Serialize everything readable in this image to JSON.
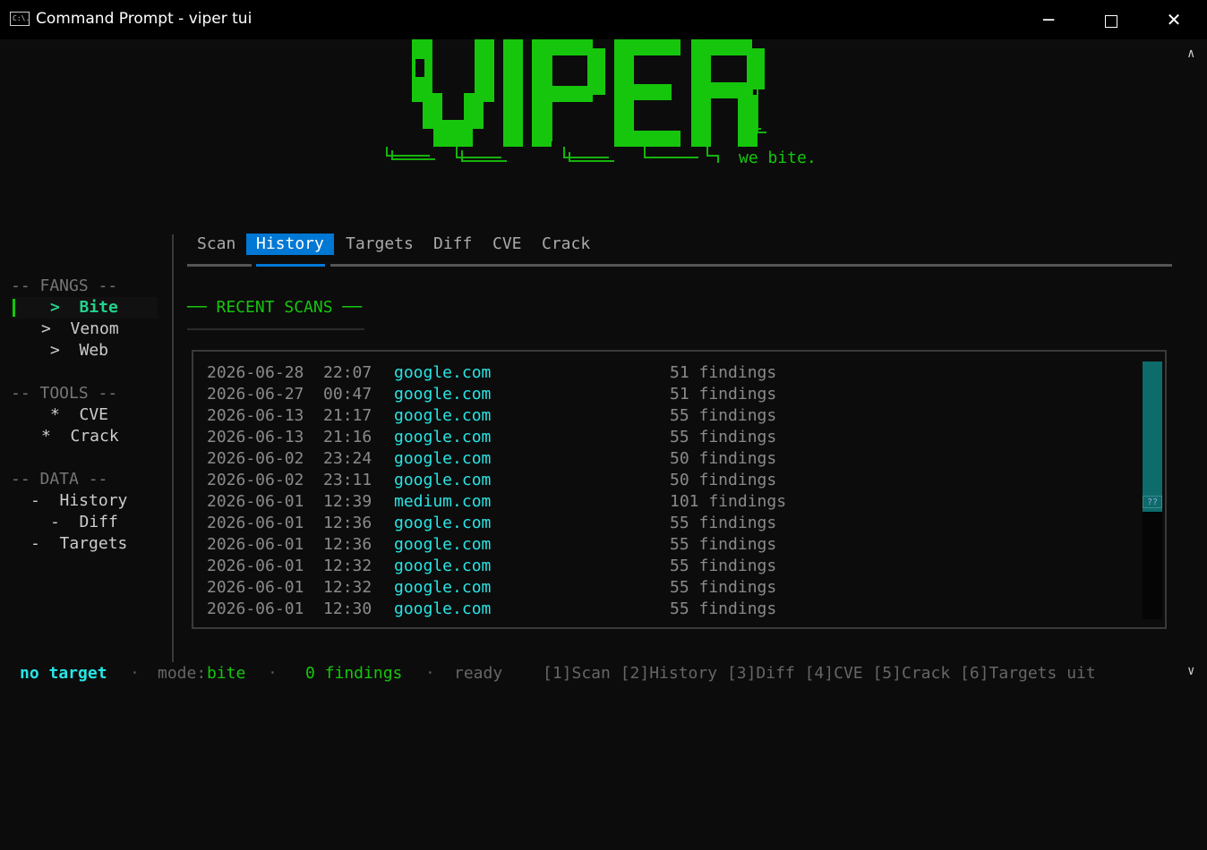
{
  "window": {
    "icon_text": "C:\\.",
    "title": "Command Prompt - viper  tui",
    "minimize": "─",
    "close": "✕"
  },
  "logo": {
    "text": "VIPER",
    "tagline": "we bite.",
    "color": "#16c60c"
  },
  "sidebar": {
    "sections": [
      {
        "title": "-- FANGS --",
        "items": [
          {
            "label": ">  Bite",
            "active": true
          },
          {
            "label": ">  Venom"
          },
          {
            "label": ">  Web"
          }
        ]
      },
      {
        "title": "-- TOOLS --",
        "items": [
          {
            "label": "*  CVE"
          },
          {
            "label": "*  Crack"
          }
        ]
      },
      {
        "title": "-- DATA --",
        "items": [
          {
            "label": "-  History"
          },
          {
            "label": "-  Diff"
          },
          {
            "label": "-  Targets"
          }
        ]
      }
    ]
  },
  "tabs": [
    {
      "label": "Scan"
    },
    {
      "label": "History",
      "active": true
    },
    {
      "label": "Targets"
    },
    {
      "label": "Diff"
    },
    {
      "label": "CVE"
    },
    {
      "label": "Crack"
    }
  ],
  "section_title": "── RECENT SCANS ──",
  "scans": [
    {
      "date": "2026-06-28  22:07",
      "host": "google.com",
      "findings": "51 findings"
    },
    {
      "date": "2026-06-27  00:47",
      "host": "google.com",
      "findings": "51 findings"
    },
    {
      "date": "2026-06-13  21:17",
      "host": "google.com",
      "findings": "55 findings"
    },
    {
      "date": "2026-06-13  21:16",
      "host": "google.com",
      "findings": "55 findings"
    },
    {
      "date": "2026-06-02  23:24",
      "host": "google.com",
      "findings": "50 findings"
    },
    {
      "date": "2026-06-02  23:11",
      "host": "google.com",
      "findings": "50 findings"
    },
    {
      "date": "2026-06-01  12:39",
      "host": "medium.com",
      "findings": "101 findings"
    },
    {
      "date": "2026-06-01  12:36",
      "host": "google.com",
      "findings": "55 findings"
    },
    {
      "date": "2026-06-01  12:36",
      "host": "google.com",
      "findings": "55 findings"
    },
    {
      "date": "2026-06-01  12:32",
      "host": "google.com",
      "findings": "55 findings"
    },
    {
      "date": "2026-06-01  12:32",
      "host": "google.com",
      "findings": "55 findings"
    },
    {
      "date": "2026-06-01  12:30",
      "host": "google.com",
      "findings": "55 findings"
    }
  ],
  "scrollbar_glyph": "??",
  "status": {
    "target": "no target",
    "separator": "·",
    "mode_label": "mode:",
    "mode": "bite",
    "findings": "0 findings",
    "state": "ready",
    "keys": "[1]Scan [2]History [3]Diff [4]CVE [5]Crack [6]Targets uit"
  },
  "colors": {
    "accent_green": "#16c60c",
    "cyan": "#29e4e4",
    "tab_active": "#0078d4",
    "scroll_thumb": "#0e6b6b"
  }
}
